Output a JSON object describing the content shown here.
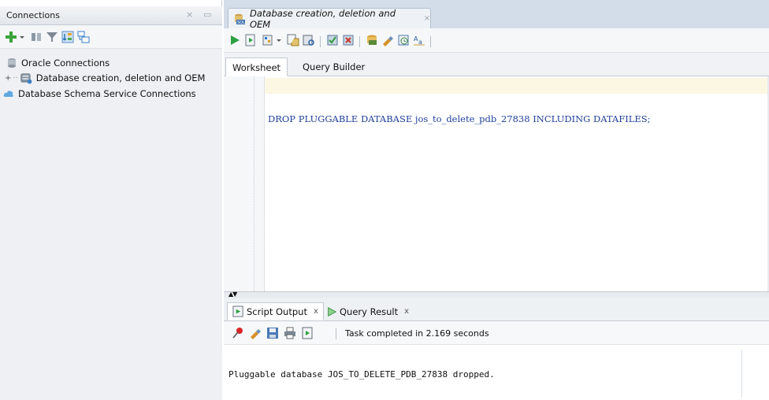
{
  "connections_panel": {
    "title": "Connections",
    "controls": {
      "minimize": "×",
      "restore": "▭"
    },
    "toolbar": {
      "icons": [
        "add-connection-icon",
        "dropdown-arrow-icon",
        "refresh-icon",
        "filter-icon",
        "schema-browser-icon",
        "connections-tree-icon"
      ]
    },
    "tree": [
      {
        "label": "Oracle Connections",
        "icon": "database-stack-icon"
      },
      {
        "label": "Database creation, deletion and OEM",
        "icon": "db-connection-icon",
        "expander": "+"
      },
      {
        "label": "Database Schema Service Connections",
        "icon": "cloud-icon"
      }
    ]
  },
  "document_tab": {
    "label": "Database creation, deletion and OEM",
    "close": "×",
    "icon": "sql-worksheet-icon"
  },
  "editor_toolbar": {
    "icons": [
      "run-statement-icon",
      "run-script-icon",
      "autotrace-icon",
      "dropdown-arrow-icon",
      "explain-plan-icon",
      "sql-tuning-icon",
      "commit-icon",
      "rollback-icon",
      "unshared-sql-icon",
      "clear-icon",
      "sql-history-icon",
      "format-icon"
    ]
  },
  "worksheet_tabs": [
    {
      "label": "Worksheet",
      "active": true
    },
    {
      "label": "Query Builder",
      "active": false
    }
  ],
  "editor": {
    "sql_line": "DROP PLUGGABLE DATABASE jos_to_delete_pdb_27838 INCLUDING DATAFILES;"
  },
  "splitter": {
    "arrows": "▲▼"
  },
  "output_tabs": [
    {
      "label": "Script Output",
      "close": "x",
      "icon": "script-output-icon",
      "active": true
    },
    {
      "label": "Query Result",
      "close": "x",
      "icon": "run-green-icon",
      "active": false
    }
  ],
  "output_toolbar": {
    "icons": [
      "pin-icon",
      "eraser-icon",
      "save-icon",
      "print-icon",
      "open-output-icon"
    ],
    "status": "Task completed in 2.169 seconds"
  },
  "output": {
    "message": "Pluggable database JOS_TO_DELETE_PDB_27838 dropped."
  }
}
